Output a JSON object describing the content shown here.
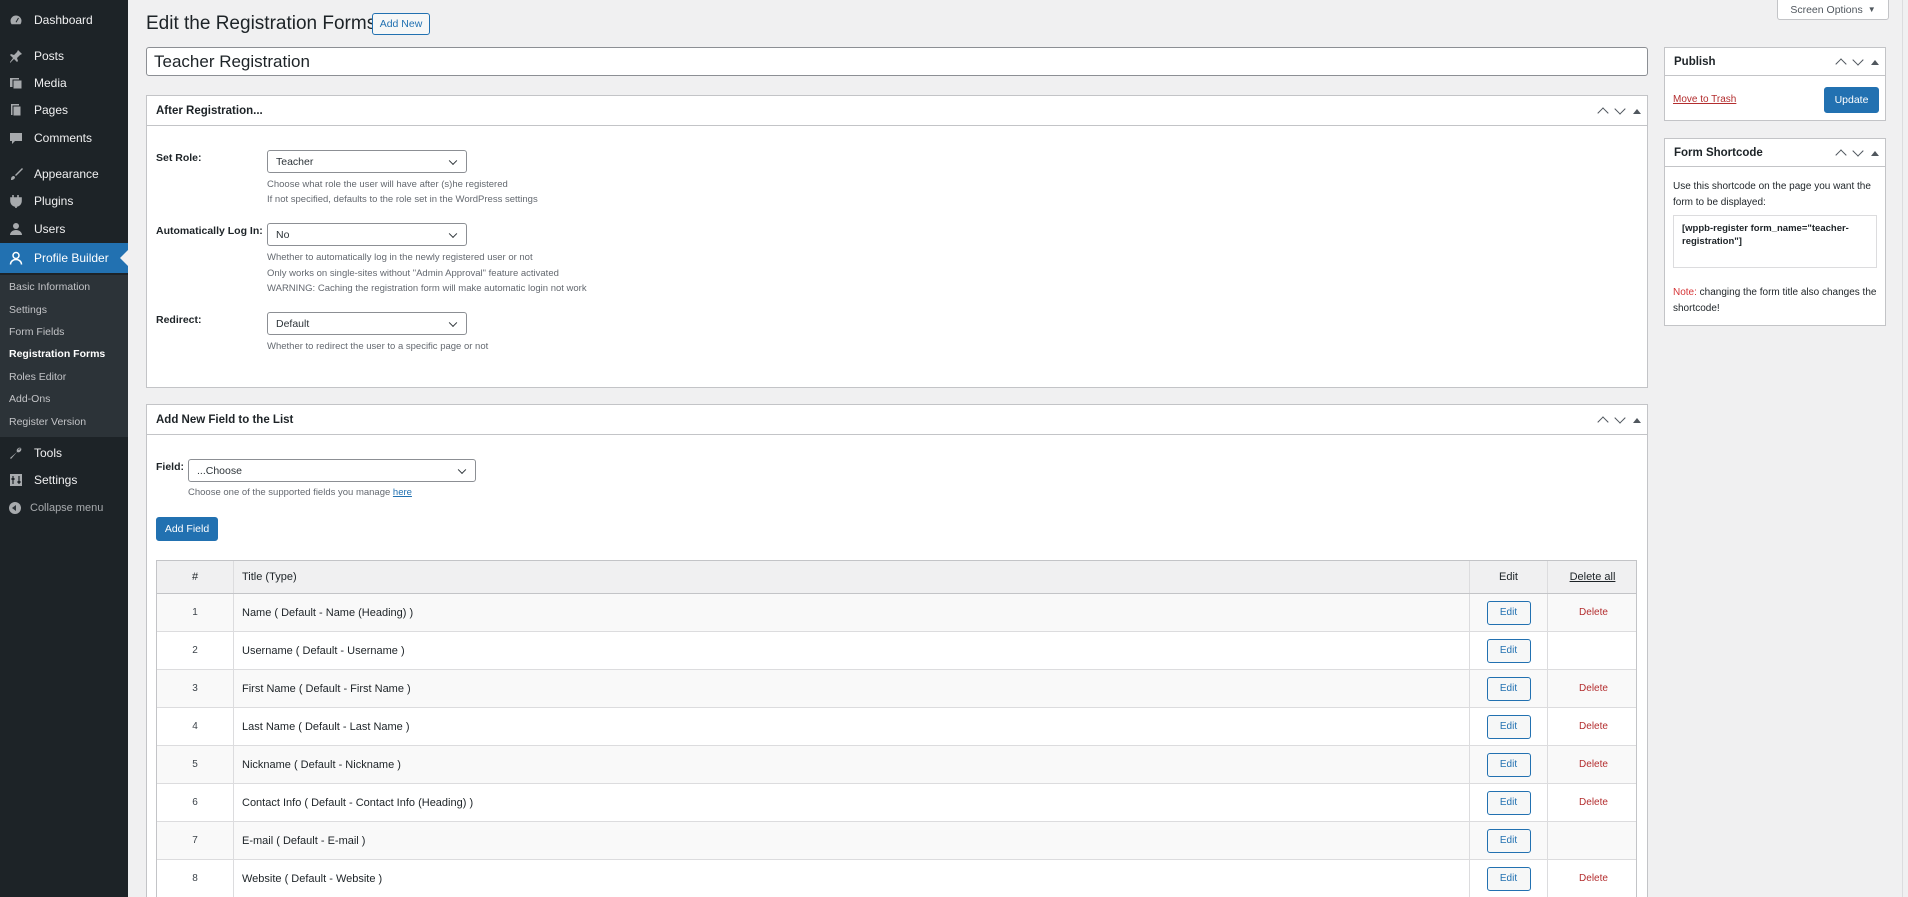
{
  "sidebar": {
    "items": [
      {
        "label": "Dashboard",
        "icon": "dashboard-icon"
      },
      {
        "label": "Posts",
        "icon": "pin-icon"
      },
      {
        "label": "Media",
        "icon": "media-icon"
      },
      {
        "label": "Pages",
        "icon": "pages-icon"
      },
      {
        "label": "Comments",
        "icon": "comment-icon"
      },
      {
        "label": "Appearance",
        "icon": "brush-icon"
      },
      {
        "label": "Plugins",
        "icon": "plug-icon"
      },
      {
        "label": "Users",
        "icon": "user-icon"
      },
      {
        "label": "Profile Builder",
        "icon": "profile-icon"
      },
      {
        "label": "Tools",
        "icon": "wrench-icon"
      },
      {
        "label": "Settings",
        "icon": "settings-icon"
      }
    ],
    "submenu": [
      "Basic Information",
      "Settings",
      "Form Fields",
      "Registration Forms",
      "Roles Editor",
      "Add-Ons",
      "Register Version"
    ],
    "collapse_label": "Collapse menu"
  },
  "header": {
    "title": "Edit the Registration Forms",
    "add_new": "Add New",
    "screen_options": "Screen Options"
  },
  "form": {
    "title_value": "Teacher Registration"
  },
  "after_registration": {
    "heading": "After Registration...",
    "set_role_label": "Set Role:",
    "set_role_value": "Teacher",
    "set_role_desc_1": "Choose what role the user will have after (s)he registered",
    "set_role_desc_2": "If not specified, defaults to the role set in the WordPress settings",
    "auto_login_label": "Automatically Log In:",
    "auto_login_value": "No",
    "auto_login_desc_1": "Whether to automatically log in the newly registered user or not",
    "auto_login_desc_2": "Only works on single-sites without \"Admin Approval\" feature activated",
    "auto_login_desc_3": "WARNING: Caching the registration form will make automatic login not work",
    "redirect_label": "Redirect:",
    "redirect_value": "Default",
    "redirect_desc": "Whether to redirect the user to a specific page or not"
  },
  "add_field": {
    "heading": "Add New Field to the List",
    "field_label": "Field:",
    "field_value": "...Choose",
    "field_desc": "Choose one of the supported fields you manage",
    "field_desc_link": "here",
    "add_button": "Add Field"
  },
  "table": {
    "headers": {
      "num": "#",
      "title": "Title (Type)",
      "edit": "Edit",
      "delete_all": "Delete all"
    },
    "edit_label": "Edit",
    "delete_label": "Delete",
    "rows": [
      {
        "num": "1",
        "title": "Name ( Default - Name (Heading) )",
        "deletable": true
      },
      {
        "num": "2",
        "title": "Username ( Default - Username )",
        "deletable": false
      },
      {
        "num": "3",
        "title": "First Name ( Default - First Name )",
        "deletable": true
      },
      {
        "num": "4",
        "title": "Last Name ( Default - Last Name )",
        "deletable": true
      },
      {
        "num": "5",
        "title": "Nickname ( Default - Nickname )",
        "deletable": true
      },
      {
        "num": "6",
        "title": "Contact Info ( Default - Contact Info (Heading) )",
        "deletable": true
      },
      {
        "num": "7",
        "title": "E-mail ( Default - E-mail )",
        "deletable": false
      },
      {
        "num": "8",
        "title": "Website ( Default - Website )",
        "deletable": true
      }
    ]
  },
  "publish": {
    "heading": "Publish",
    "trash": "Move to Trash",
    "update": "Update"
  },
  "shortcode": {
    "heading": "Form Shortcode",
    "desc": "Use this shortcode on the page you want the form to be displayed:",
    "code": "[wppb-register form_name=\"teacher-registration\"]",
    "note_label": "Note:",
    "note_text": " changing the form title also changes the shortcode!"
  },
  "colors": {
    "accent": "#2271b1",
    "sidebar_bg": "#1d2327",
    "delete": "#b32d2e"
  }
}
